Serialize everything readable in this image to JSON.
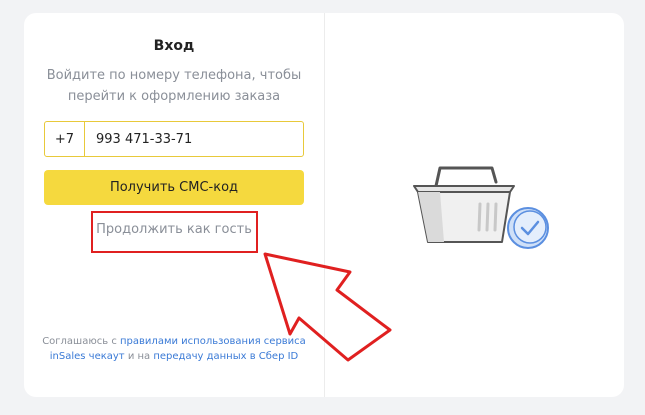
{
  "login": {
    "title": "Вход",
    "subtitle": "Войдите по номеру телефона, чтобы перейти к оформлению заказа",
    "phone_prefix": "+7",
    "phone_value": "993 471-33-71",
    "sms_button_label": "Получить СМС-код",
    "guest_link_label": "Продолжить как гость"
  },
  "consent": {
    "prefix": "Соглашаюсь с ",
    "link1": "правилами использования сервиса inSales чекаут",
    "middle": " и на ",
    "link2": "передачу данных в Сбер ID"
  },
  "colors": {
    "accent": "#f5d93e",
    "link": "#3a7ad6",
    "highlight": "#e02020",
    "check": "#5b8fe0"
  },
  "icons": {
    "illustration": "shopping-basket-icon",
    "check": "check-circle-icon",
    "pointer": "arrow-pointer-icon"
  }
}
